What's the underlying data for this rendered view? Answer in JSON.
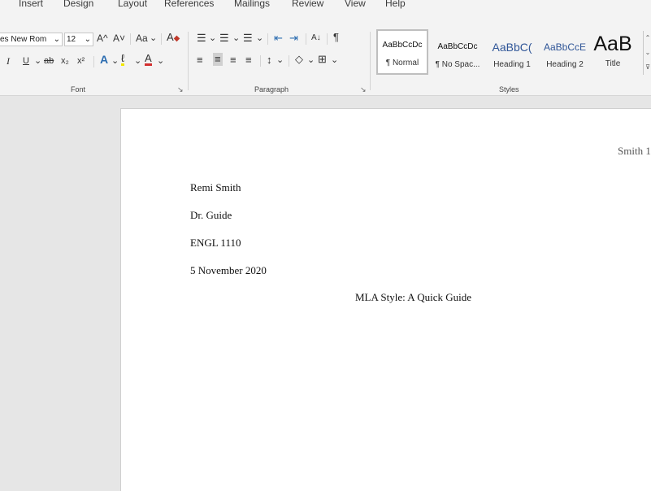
{
  "tabs": [
    "Insert",
    "Design",
    "Layout",
    "References",
    "Mailings",
    "Review",
    "View",
    "Help"
  ],
  "font": {
    "name": "es New Rom",
    "size": "12",
    "grow_label": "A^",
    "shrink_label": "A˅",
    "case_label": "Aa",
    "clear_label": "A",
    "italic": "I",
    "underline": "U",
    "strike": "ab",
    "subscript": "x₂",
    "superscript": "x²",
    "effects_label": "A",
    "highlight_label": "ℓ",
    "color_label": "A",
    "group_label": "Font"
  },
  "paragraph": {
    "sort_label": "A↓",
    "pilcrow_label": "¶",
    "group_label": "Paragraph"
  },
  "styles": {
    "items": [
      {
        "preview": "AaBbCcDc",
        "label": "¶ Normal"
      },
      {
        "preview": "AaBbCcDc",
        "label": "¶ No Spac..."
      },
      {
        "preview": "AaBbC(",
        "label": "Heading 1"
      },
      {
        "preview": "AaBbCcE",
        "label": "Heading 2"
      },
      {
        "preview": "AaB",
        "label": "Title"
      }
    ],
    "group_label": "Styles"
  },
  "document": {
    "header_text": "Smith 1",
    "lines": [
      "Remi Smith",
      "Dr. Guide",
      "ENGL 1110",
      "5 November 2020"
    ],
    "title": "MLA Style: A Quick Guide"
  },
  "colors": {
    "highlight": "#f2e600",
    "font_color": "#d32f2f",
    "heading_blue": "#2f5597"
  }
}
